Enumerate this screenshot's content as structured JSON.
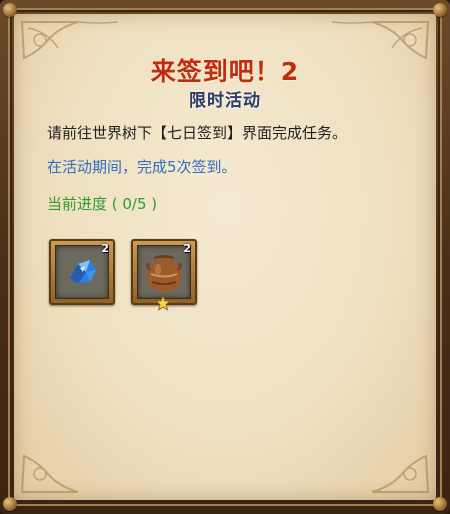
{
  "header": {
    "title": "来签到吧！2",
    "subtitle": "限时活动"
  },
  "body": {
    "description": "请前往世界树下【七日签到】界面完成任务。",
    "period_text": "在活动期间，完成5次签到。",
    "progress_text": "当前进度 ( 0/5 )"
  },
  "rewards": [
    {
      "item": "blue-crystal-icon",
      "count": "2"
    },
    {
      "item": "clay-pot-icon",
      "count": "2",
      "starred": true
    }
  ],
  "colors": {
    "title": "#c22a12",
    "subtitle": "#2e3a5e",
    "period": "#2f6ec4",
    "progress": "#2e9a30",
    "parchment": "#f2e5c8"
  }
}
